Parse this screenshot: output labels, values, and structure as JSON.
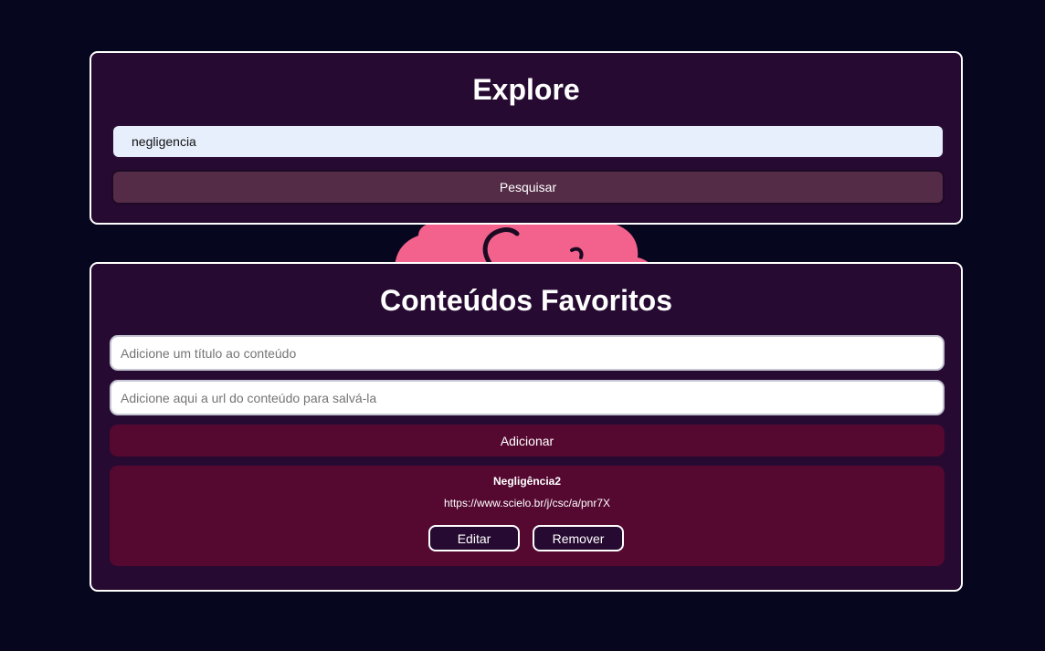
{
  "explore": {
    "title": "Explore",
    "search_value": "negligencia",
    "search_button": "Pesquisar"
  },
  "favorites": {
    "title": "Conteúdos Favoritos",
    "title_placeholder": "Adicione um título ao conteúdo",
    "url_placeholder": "Adicione aqui a url do conteúdo para salvá-la",
    "add_button": "Adicionar",
    "items": [
      {
        "title": "Negligência2",
        "url": "https://www.scielo.br/j/csc/a/pnr7X",
        "edit_label": "Editar",
        "remove_label": "Remover"
      }
    ]
  },
  "colors": {
    "background": "#07061f",
    "panel": "#260a32",
    "accent": "#550931",
    "search_button": "#542c47",
    "mascot": "#f2628c"
  },
  "icons": {
    "mascot": "pink-blob-mascot-icon"
  }
}
